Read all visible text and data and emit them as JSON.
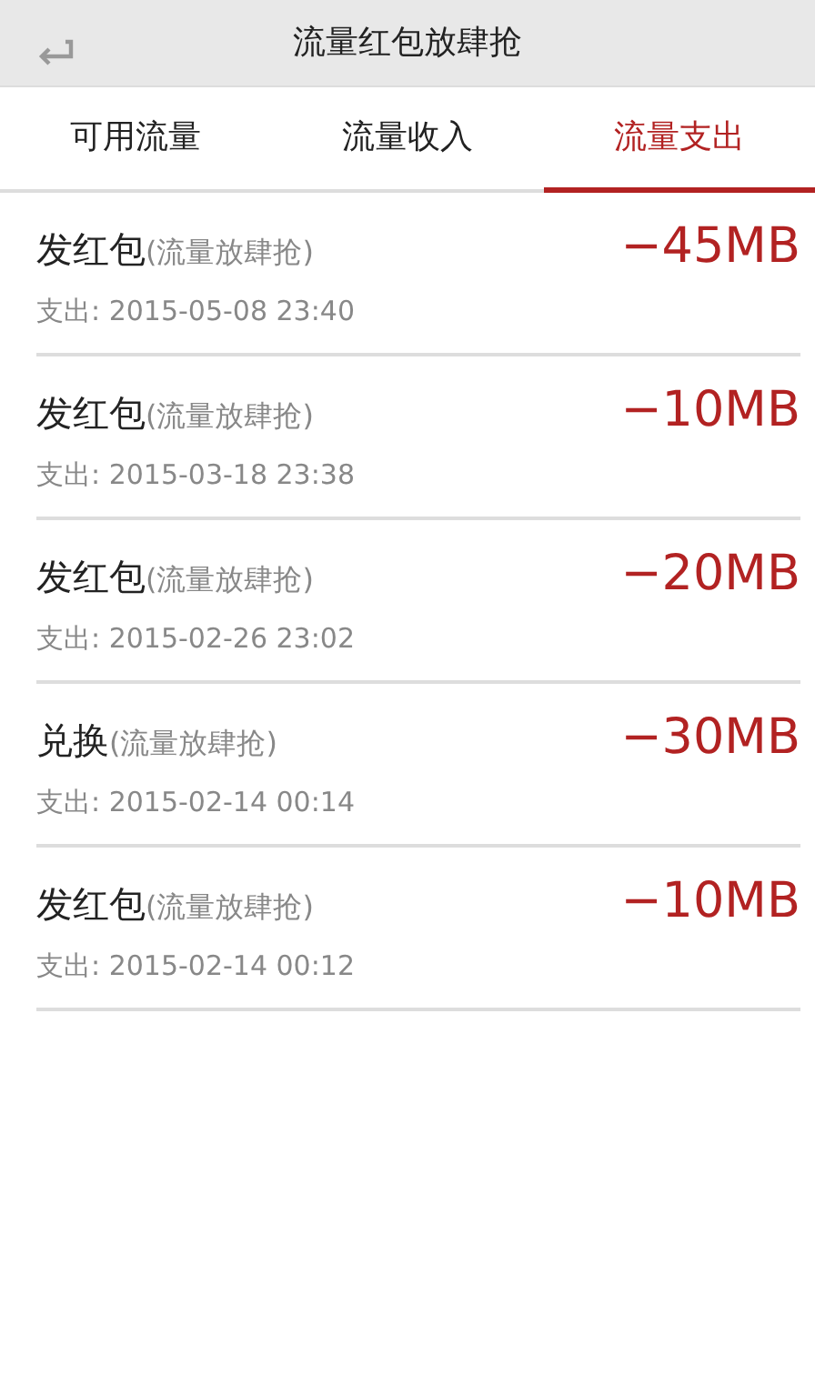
{
  "header": {
    "title": "流量红包放肆抢"
  },
  "tabs": [
    {
      "label": "可用流量",
      "selected": false
    },
    {
      "label": "流量收入",
      "selected": false
    },
    {
      "label": "流量支出",
      "selected": true
    }
  ],
  "records": [
    {
      "name": "发红包",
      "source": "(流量放肆抢)",
      "time": "支出: 2015-05-08 23:40",
      "amount": "−45MB"
    },
    {
      "name": "发红包",
      "source": "(流量放肆抢)",
      "time": "支出: 2015-03-18 23:38",
      "amount": "−10MB"
    },
    {
      "name": "发红包",
      "source": "(流量放肆抢)",
      "time": "支出: 2015-02-26 23:02",
      "amount": "−20MB"
    },
    {
      "name": "兑换",
      "source": "(流量放肆抢)",
      "time": "支出: 2015-02-14 00:14",
      "amount": "−30MB"
    },
    {
      "name": "发红包",
      "source": "(流量放肆抢)",
      "time": "支出: 2015-02-14 00:12",
      "amount": "−10MB"
    }
  ]
}
